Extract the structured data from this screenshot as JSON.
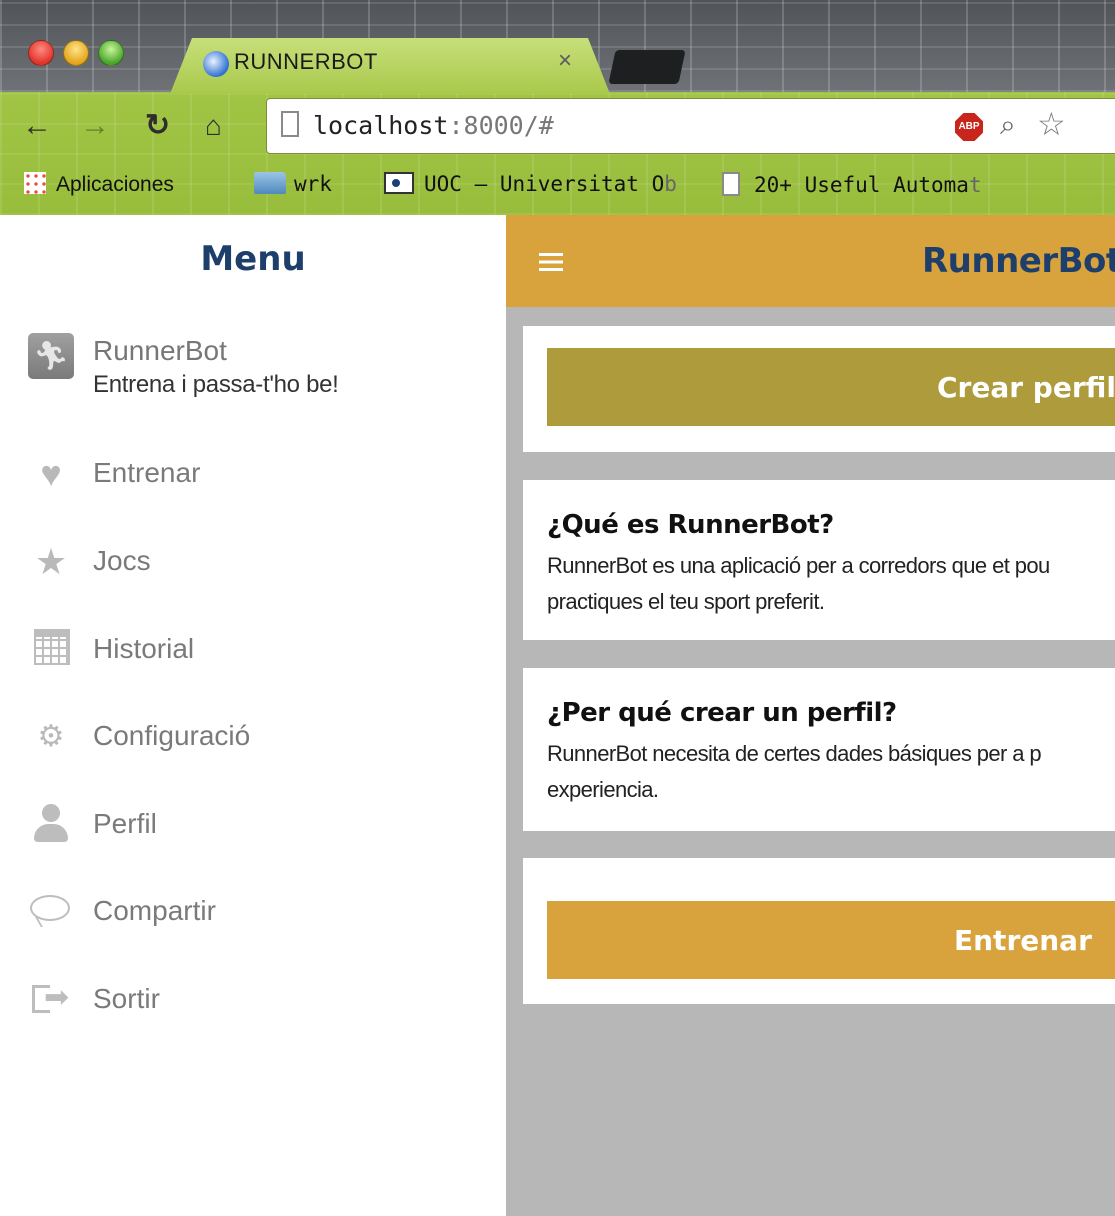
{
  "browser": {
    "tab_title": "RUNNERBOT",
    "tab_close": "×",
    "url_host": "localhost",
    "url_rest": ":8000/#",
    "abp_label": "ABP",
    "bookmarks": [
      {
        "label": "Aplicaciones",
        "icon": "apps-icon"
      },
      {
        "label": "wrk",
        "icon": "folder-icon"
      },
      {
        "label": "UOC – Universitat O",
        "fade": "b",
        "icon": "uoc-icon"
      },
      {
        "label": "20+ Useful Automa",
        "fade": "t",
        "icon": "document-icon"
      }
    ]
  },
  "menu": {
    "title": "Menu",
    "profile": {
      "name": "RunnerBot",
      "tagline": "Entrena i passa-t'ho be!"
    },
    "items": [
      {
        "label": "Entrenar",
        "icon": "heart-icon"
      },
      {
        "label": "Jocs",
        "icon": "star-icon"
      },
      {
        "label": "Historial",
        "icon": "calendar-icon"
      },
      {
        "label": "Configuració",
        "icon": "gears-icon"
      },
      {
        "label": "Perfil",
        "icon": "user-icon"
      },
      {
        "label": "Compartir",
        "icon": "chat-bubble-icon"
      },
      {
        "label": "Sortir",
        "icon": "sign-out-icon"
      }
    ]
  },
  "app": {
    "title": "RunnerBot",
    "create_profile_button": "Crear perfil",
    "sections": [
      {
        "title": "¿Qué es RunnerBot?",
        "text": "RunnerBot es una aplicació per a corredors que et pou practiques el teu sport preferit."
      },
      {
        "title": "¿Per qué crear un perfil?",
        "text": "RunnerBot necesita de certes dades básiques per a p experiencia."
      }
    ],
    "train_button": "Entrenar"
  },
  "colors": {
    "header": "#d8a23d",
    "olive_button": "#ad9b3c",
    "title_blue": "#1e3f6b",
    "content_bg": "#b7b7b7"
  }
}
